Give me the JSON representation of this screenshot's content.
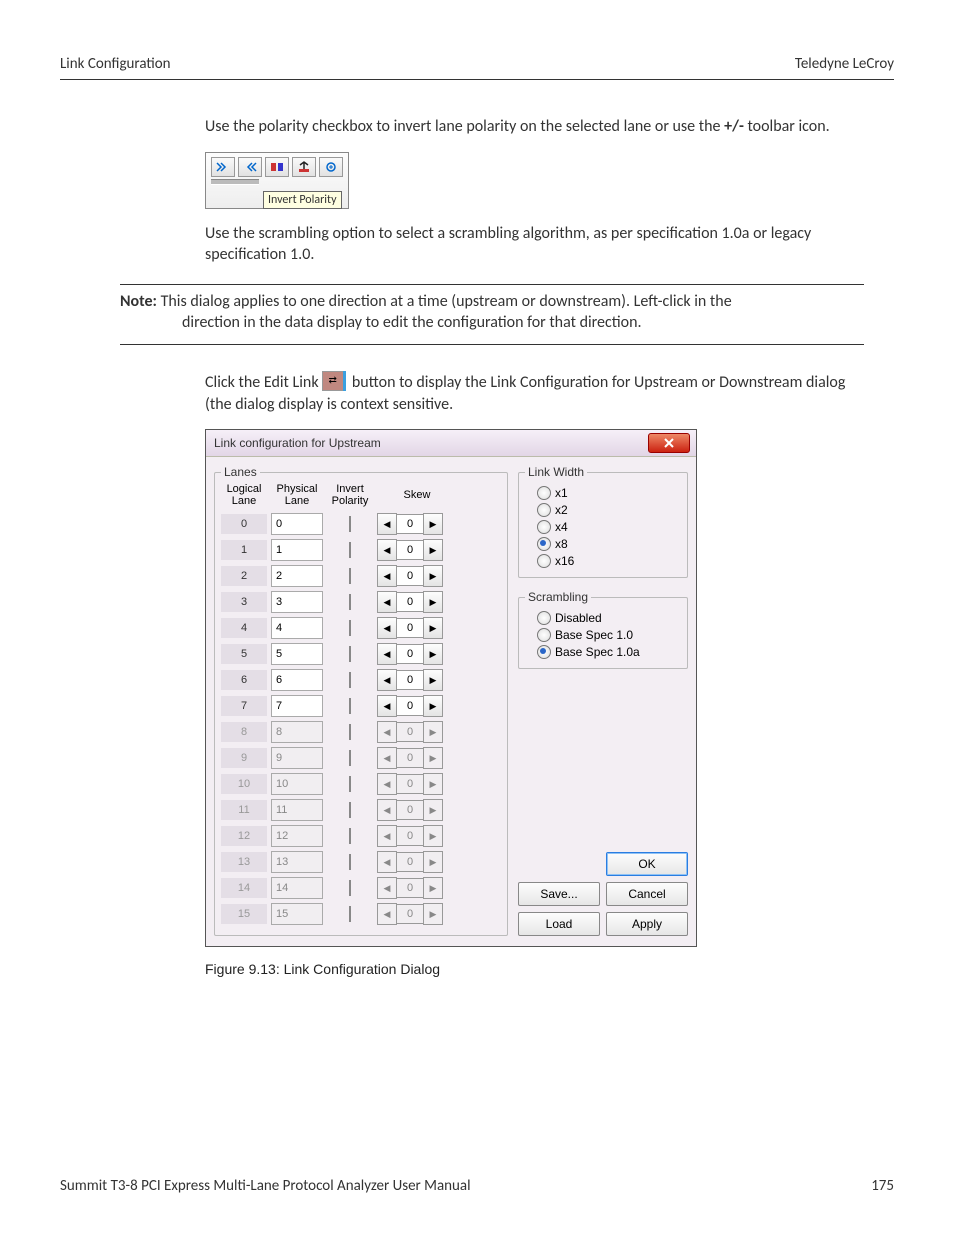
{
  "header": {
    "left": "Link Configuration",
    "right": "Teledyne LeCroy"
  },
  "para1_a": "Use the polarity checkbox to invert lane polarity on the selected lane or use the ",
  "para1_b": "+/-",
  "para1_c": " toolbar icon.",
  "toolbar_tip": "Invert Polarity",
  "para2": "Use the scrambling option to select a scrambling algorithm, as per specification 1.0a or legacy specification 1.0.",
  "note_label": "Note:",
  "note_text_1": " This dialog applies to one direction at a time (upstream or downstream). Left-click in the",
  "note_text_2": "direction in the data display to edit the configuration for that direction.",
  "para3_a": "Click the Edit Link ",
  "para3_b": " button to display the Link Configuration for Upstream or Downstream dialog (the dialog display is context sensitive.",
  "dialog": {
    "title": "Link configuration for Upstream",
    "lanes_legend": "Lanes",
    "headers": {
      "logical": "Logical Lane",
      "physical": "Physical Lane",
      "invert": "Invert Polarity",
      "skew": "Skew"
    },
    "rows": [
      {
        "logical": "0",
        "physical": "0",
        "skew": "0",
        "enabled": true
      },
      {
        "logical": "1",
        "physical": "1",
        "skew": "0",
        "enabled": true
      },
      {
        "logical": "2",
        "physical": "2",
        "skew": "0",
        "enabled": true
      },
      {
        "logical": "3",
        "physical": "3",
        "skew": "0",
        "enabled": true
      },
      {
        "logical": "4",
        "physical": "4",
        "skew": "0",
        "enabled": true
      },
      {
        "logical": "5",
        "physical": "5",
        "skew": "0",
        "enabled": true
      },
      {
        "logical": "6",
        "physical": "6",
        "skew": "0",
        "enabled": true
      },
      {
        "logical": "7",
        "physical": "7",
        "skew": "0",
        "enabled": true
      },
      {
        "logical": "8",
        "physical": "8",
        "skew": "0",
        "enabled": false
      },
      {
        "logical": "9",
        "physical": "9",
        "skew": "0",
        "enabled": false
      },
      {
        "logical": "10",
        "physical": "10",
        "skew": "0",
        "enabled": false
      },
      {
        "logical": "11",
        "physical": "11",
        "skew": "0",
        "enabled": false
      },
      {
        "logical": "12",
        "physical": "12",
        "skew": "0",
        "enabled": false
      },
      {
        "logical": "13",
        "physical": "13",
        "skew": "0",
        "enabled": false
      },
      {
        "logical": "14",
        "physical": "14",
        "skew": "0",
        "enabled": false
      },
      {
        "logical": "15",
        "physical": "15",
        "skew": "0",
        "enabled": false
      }
    ],
    "link_width": {
      "legend": "Link Width",
      "options": [
        "x1",
        "x2",
        "x4",
        "x8",
        "x16"
      ],
      "selected": "x8"
    },
    "scrambling": {
      "legend": "Scrambling",
      "options": [
        "Disabled",
        "Base Spec 1.0",
        "Base Spec 1.0a"
      ],
      "selected": "Base Spec 1.0a"
    },
    "buttons": {
      "ok": "OK",
      "save": "Save...",
      "cancel": "Cancel",
      "load": "Load",
      "apply": "Apply"
    }
  },
  "figure_caption": "Figure 9.13:  Link Configuration Dialog",
  "footer": {
    "left": "Summit T3-8 PCI Express Multi-Lane Protocol Analyzer User Manual",
    "right": "175"
  }
}
